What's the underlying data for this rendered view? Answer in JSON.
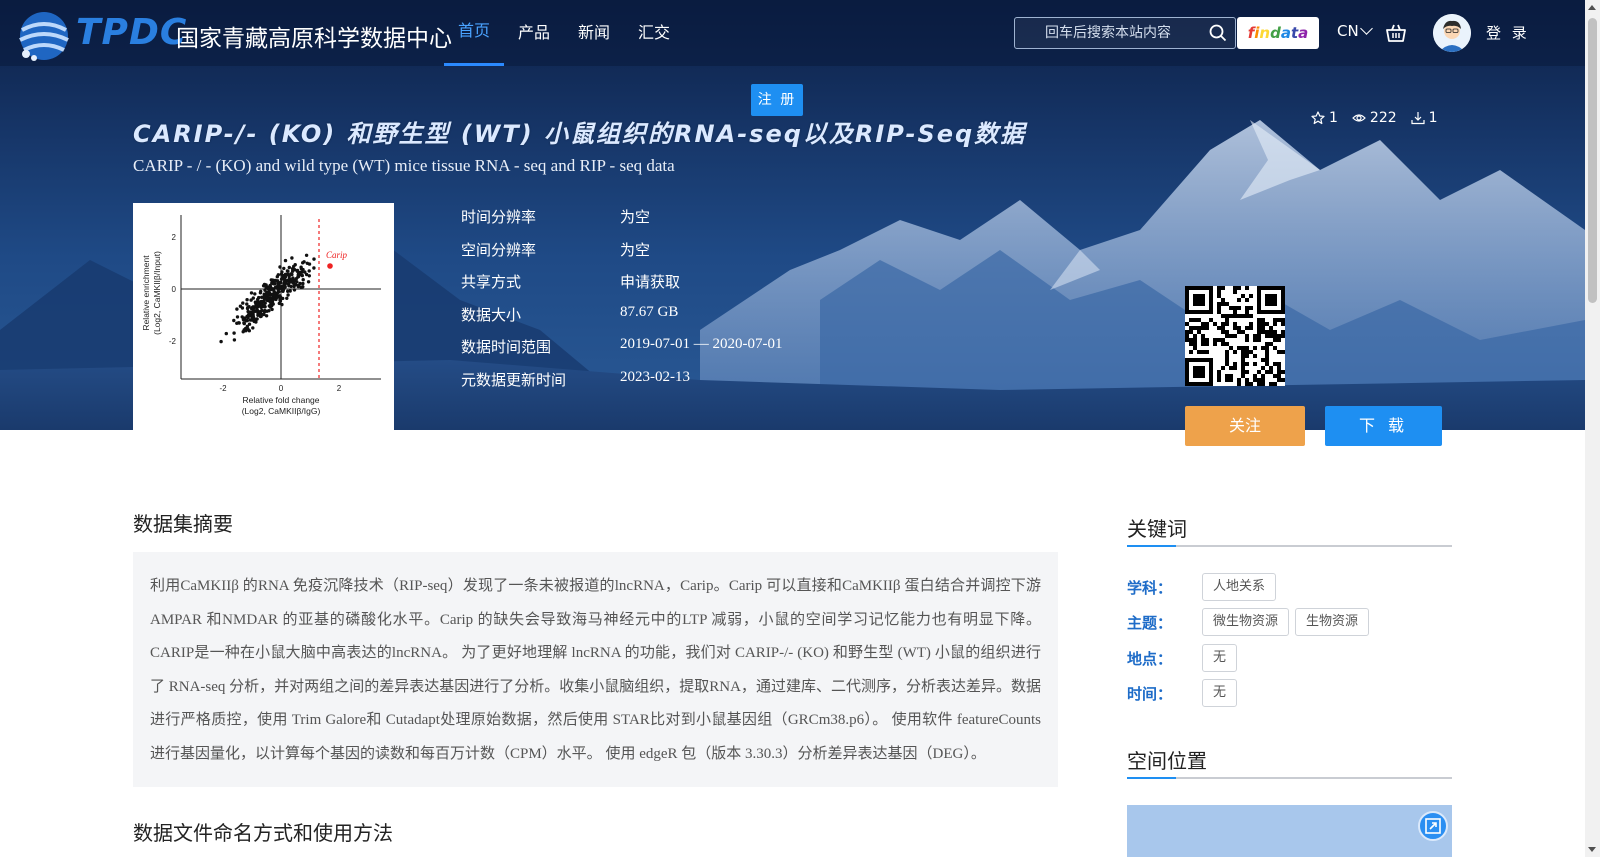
{
  "header": {
    "logo_abbr": "TPDC",
    "logo_name": "国家青藏高原科学数据中心",
    "nav": [
      {
        "label": "首页"
      },
      {
        "label": "产品"
      },
      {
        "label": "新闻"
      },
      {
        "label": "汇交"
      }
    ],
    "search_placeholder": "回车后搜索本站内容",
    "findata_label": [
      "f",
      "i",
      "n",
      "d",
      "a",
      "t",
      "a"
    ],
    "findata_colors": [
      "#e53935",
      "#fb8c00",
      "#fdd835",
      "#43a047",
      "#1e88e5",
      "#3949ab",
      "#8e24aa"
    ],
    "language": "CN",
    "login_label": "登 录",
    "register_label": "注 册"
  },
  "dataset": {
    "title_cn": "CARIP-/- (KO) 和野生型 (WT) 小鼠组织的RNA-seq以及RIP-Seq数据",
    "title_en": "CARIP - / - (KO) and wild type (WT) mice tissue RNA - seq and RIP - seq data",
    "stats": {
      "favorites": "1",
      "views": "222",
      "downloads": "1"
    },
    "meta": [
      {
        "label": "时间分辨率",
        "value": "为空"
      },
      {
        "label": "空间分辨率",
        "value": "为空"
      },
      {
        "label": "共享方式",
        "value": "申请获取"
      },
      {
        "label": "数据大小",
        "value": "87.67 GB"
      },
      {
        "label": "数据时间范围",
        "value": "2019-07-01 — 2020-07-01"
      },
      {
        "label": "元数据更新时间",
        "value": "2023-02-13"
      }
    ],
    "follow_label": "关注",
    "download_label": "下 载"
  },
  "thumbnail": {
    "xlabel_line1": "Relative fold change",
    "xlabel_line2": "(Log2, CaMKIIβ/IgG)",
    "ylabel_line1": "Relative enrichment",
    "ylabel_line2": "(Log2, CaMKIIβ/Input)",
    "highlight_label": "Carip",
    "xticks": [
      "-2",
      "0",
      "2"
    ],
    "yticks": [
      "2",
      "0",
      "-2"
    ]
  },
  "main": {
    "abstract_title": "数据集摘要",
    "abstract_text": "利用CaMKIIβ 的RNA 免疫沉降技术（RIP-seq）发现了一条未被报道的lncRNA，Carip。Carip 可以直接和CaMKIIβ 蛋白结合并调控下游AMPAR 和NMDAR 的亚基的磷酸化水平。Carip 的缺失会导致海马神经元中的LTP 减弱，小鼠的空间学习记忆能力也有明显下降。CARIP是一种在小鼠大脑中高表达的lncRNA。 为了更好地理解 lncRNA 的功能，我们对 CARIP-/- (KO) 和野生型 (WT) 小鼠的组织进行了 RNA-seq 分析，并对两组之间的差异表达基因进行了分析。收集小鼠脑组织，提取RNA，通过建库、二代测序，分析表达差异。数据进行严格质控，使用 Trim Galore和 Cutadapt处理原始数据，然后使用 STAR比对到小鼠基因组（GRCm38.p6）。 使用软件 featureCounts 进行基因量化，以计算每个基因的读数和每百万计数（CPM）水平。 使用 edgeR 包（版本 3.30.3）分析差异表达基因（DEG）。",
    "naming_title": "数据文件命名方式和使用方法"
  },
  "sidebar": {
    "keywords_title": "关键词",
    "keywords": [
      {
        "label": "学科：",
        "tags": [
          "人地关系"
        ]
      },
      {
        "label": "主题：",
        "tags": [
          "微生物资源",
          "生物资源"
        ]
      },
      {
        "label": "地点：",
        "tags": [
          "无"
        ]
      },
      {
        "label": "时间：",
        "tags": [
          "无"
        ]
      }
    ],
    "location_title": "空间位置"
  }
}
